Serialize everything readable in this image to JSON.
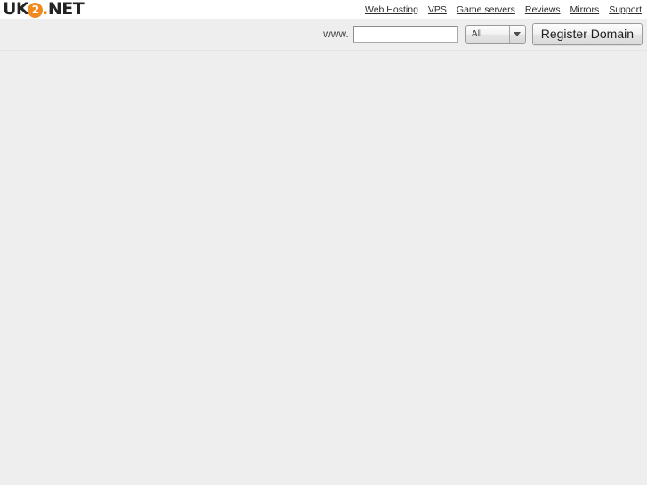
{
  "header": {
    "logo": {
      "prefix": "UK",
      "badge": "2",
      "dot": ".",
      "suffix": "NET",
      "full_text": "UK2.NET",
      "badge_color": "#f08a1e"
    },
    "nav": [
      {
        "label": "Web Hosting"
      },
      {
        "label": "VPS"
      },
      {
        "label": "Game servers"
      },
      {
        "label": "Reviews"
      },
      {
        "label": "Mirrors"
      },
      {
        "label": "Support"
      }
    ]
  },
  "search": {
    "www_label": "www.",
    "domain_value": "",
    "domain_placeholder": "",
    "tld_selected": "All",
    "tld_options": [
      "All"
    ],
    "dropdown_icon": "chevron-down-icon",
    "register_label": "Register Domain"
  },
  "colors": {
    "page_background": "#eeeeee",
    "topbar_background": "#ffffff",
    "accent": "#f08a1e",
    "link_text": "#2d2d2d"
  },
  "body": {
    "content": ""
  }
}
